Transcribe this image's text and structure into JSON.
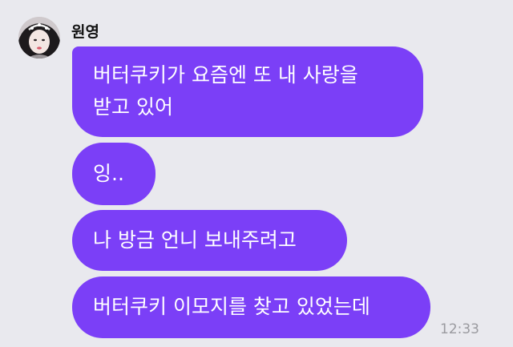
{
  "sender": {
    "name": "원영"
  },
  "messages": [
    {
      "lines": [
        "버터쿠키가 요즘엔 또 내 사랑을",
        "받고 있어"
      ]
    },
    {
      "lines": [
        "잉.."
      ]
    },
    {
      "lines": [
        "나 방금 언니 보내주려고"
      ]
    },
    {
      "lines": [
        "버터쿠키 이모지를 찾고 있었는데"
      ]
    }
  ],
  "timestamp": "12:33",
  "colors": {
    "background": "#e9e9ee",
    "bubble": "#7b3ff7",
    "bubble_text": "#ffffff",
    "timestamp": "#9a9a9f"
  },
  "icons": {
    "avatar": "profile-photo"
  }
}
